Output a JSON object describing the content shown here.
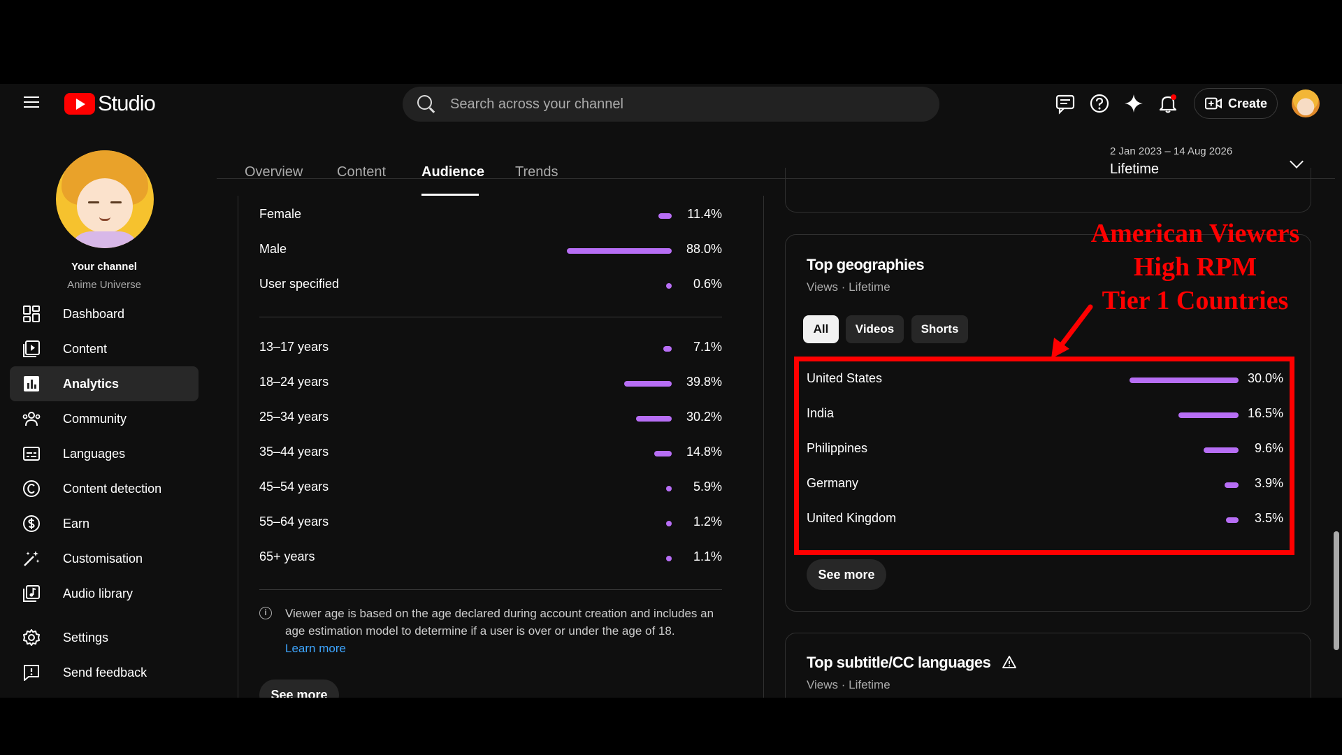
{
  "app": {
    "brand": "Studio"
  },
  "search": {
    "placeholder": "Search across your channel"
  },
  "topbar": {
    "create_label": "Create"
  },
  "channel": {
    "title": "Your channel",
    "name": "Anime Universe"
  },
  "sidebar": {
    "items": [
      {
        "label": "Dashboard",
        "icon": "dashboard-icon"
      },
      {
        "label": "Content",
        "icon": "content-icon"
      },
      {
        "label": "Analytics",
        "icon": "analytics-icon",
        "active": true
      },
      {
        "label": "Community",
        "icon": "community-icon"
      },
      {
        "label": "Languages",
        "icon": "languages-icon"
      },
      {
        "label": "Content detection",
        "icon": "copyright-icon"
      },
      {
        "label": "Earn",
        "icon": "dollar-icon"
      },
      {
        "label": "Customisation",
        "icon": "magic-wand-icon"
      },
      {
        "label": "Audio library",
        "icon": "audio-library-icon"
      },
      {
        "label": "Settings",
        "icon": "gear-icon"
      },
      {
        "label": "Send feedback",
        "icon": "feedback-icon"
      }
    ]
  },
  "tabs": [
    {
      "label": "Overview"
    },
    {
      "label": "Content"
    },
    {
      "label": "Audience",
      "active": true
    },
    {
      "label": "Trends"
    }
  ],
  "date_range": {
    "range": "2 Jan 2023 – 14 Aug 2026",
    "label": "Lifetime"
  },
  "gender": [
    {
      "label": "Female",
      "value": "11.4%",
      "fraction": 0.114
    },
    {
      "label": "Male",
      "value": "88.0%",
      "fraction": 0.88
    },
    {
      "label": "User specified",
      "value": "0.6%",
      "fraction": 0.006
    }
  ],
  "age": [
    {
      "label": "13–17 years",
      "value": "7.1%",
      "fraction": 0.071
    },
    {
      "label": "18–24 years",
      "value": "39.8%",
      "fraction": 0.398
    },
    {
      "label": "25–34 years",
      "value": "30.2%",
      "fraction": 0.302
    },
    {
      "label": "35–44 years",
      "value": "14.8%",
      "fraction": 0.148
    },
    {
      "label": "45–54 years",
      "value": "5.9%",
      "fraction": 0.059
    },
    {
      "label": "55–64 years",
      "value": "1.2%",
      "fraction": 0.012
    },
    {
      "label": "65+ years",
      "value": "1.1%",
      "fraction": 0.011
    }
  ],
  "age_info": {
    "text": "Viewer age is based on the age declared during account creation and includes an age estimation model to determine if a user is over or under the age of 18.",
    "link": "Learn more"
  },
  "see_more": "See more",
  "geographies": {
    "title": "Top geographies",
    "subtitle": "Views · Lifetime",
    "chips": [
      "All",
      "Videos",
      "Shorts"
    ],
    "rows": [
      {
        "label": "United States",
        "value": "30.0%",
        "fraction": 0.3
      },
      {
        "label": "India",
        "value": "16.5%",
        "fraction": 0.165
      },
      {
        "label": "Philippines",
        "value": "9.6%",
        "fraction": 0.096
      },
      {
        "label": "Germany",
        "value": "3.9%",
        "fraction": 0.039
      },
      {
        "label": "United Kingdom",
        "value": "3.5%",
        "fraction": 0.035
      }
    ]
  },
  "subtitles": {
    "title": "Top subtitle/CC languages",
    "subtitle": "Views · Lifetime"
  },
  "annotation": {
    "lines": [
      "American Viewers",
      "High RPM",
      "Tier 1 Countries"
    ],
    "color": "#ff0000"
  },
  "colors": {
    "bar": "#b76ef5",
    "accent": "#3ea6ff"
  }
}
